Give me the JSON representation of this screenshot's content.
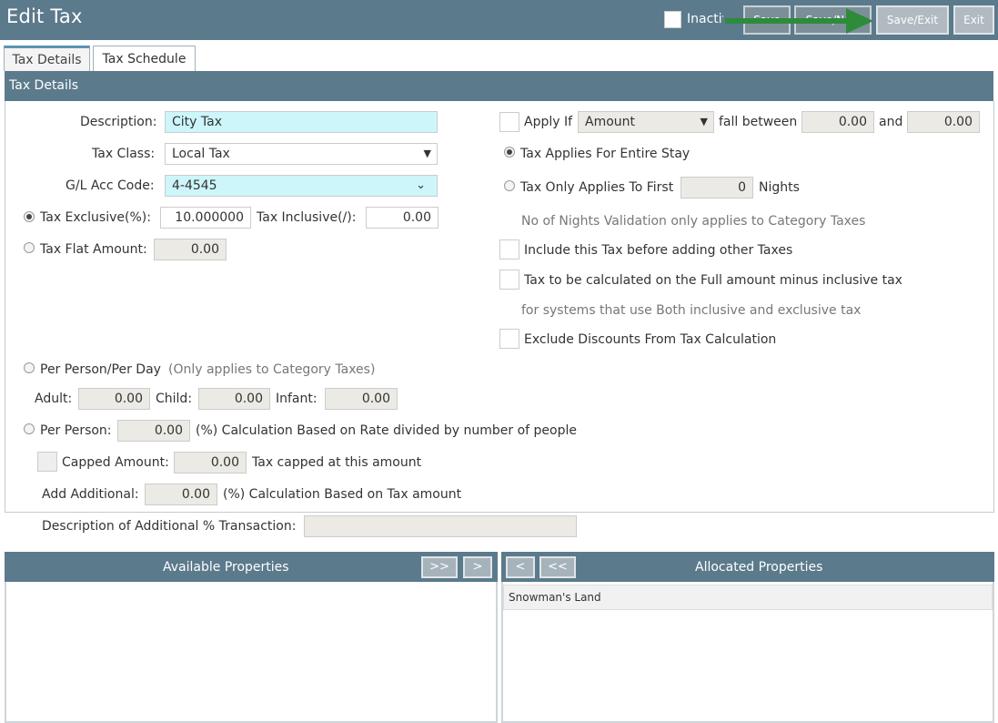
{
  "header": {
    "title": "Edit Tax",
    "inactive_label": "Inactive",
    "buttons": {
      "save": "Save",
      "save_new": "Save/New",
      "save_exit": "Save/Exit",
      "exit": "Exit"
    },
    "arrow_color": "#2e8b3a"
  },
  "tabs": [
    {
      "label": "Tax Details"
    },
    {
      "label": "Tax Schedule"
    }
  ],
  "panel": {
    "title": "Tax Details"
  },
  "form": {
    "description_label": "Description:",
    "description_value": "City Tax",
    "tax_class_label": "Tax Class:",
    "tax_class_value": "Local Tax",
    "gl_label": "G/L Acc Code:",
    "gl_value": "4-4545",
    "tax_exclusive_label": "Tax Exclusive(%):",
    "tax_exclusive_value": "10.000000",
    "tax_inclusive_label": "Tax Inclusive(/):",
    "tax_inclusive_value": "0.00",
    "flat_label": "Tax Flat Amount:",
    "flat_value": "0.00",
    "per_person_day_label": "Per Person/Per Day",
    "per_person_day_note": "(Only applies to Category Taxes)",
    "adult_label": "Adult:",
    "adult_value": "0.00",
    "child_label": "Child:",
    "child_value": "0.00",
    "infant_label": "Infant:",
    "infant_value": "0.00",
    "per_person_label": "Per Person:",
    "per_person_value": "0.00",
    "per_person_note": "(%) Calculation Based on Rate divided by number of people",
    "capped_label": "Capped Amount:",
    "capped_value": "0.00",
    "capped_note": "Tax capped at this amount",
    "add_additional_label": "Add Additional:",
    "add_additional_value": "0.00",
    "add_additional_note": "(%) Calculation Based on Tax amount",
    "desc_additional_label": "Description of Additional % Transaction:",
    "desc_additional_value": ""
  },
  "right": {
    "apply_if_label": "Apply If",
    "apply_if_select": "Amount",
    "fall_between_label": "fall between",
    "from_value": "0.00",
    "and_label": "and",
    "to_value": "0.00",
    "entire_stay_label": "Tax Applies For Entire Stay",
    "first_label": "Tax Only Applies To First",
    "first_value": "0",
    "nights_label": "Nights",
    "nights_note": "No of Nights Validation only applies to Category Taxes",
    "include_label": "Include this Tax before adding other Taxes",
    "full_amount_label": "Tax to be calculated on the Full amount minus inclusive tax",
    "full_amount_note": "for systems that use Both inclusive and exclusive tax",
    "exclude_label": "Exclude Discounts From Tax Calculation"
  },
  "properties": {
    "available_title": "Available Properties",
    "allocated_title": "Allocated Properties",
    "btn_all_right": ">>",
    "btn_right": ">",
    "btn_left": "<",
    "btn_all_left": "<<",
    "allocated_items": [
      "Snowman's Land"
    ]
  }
}
